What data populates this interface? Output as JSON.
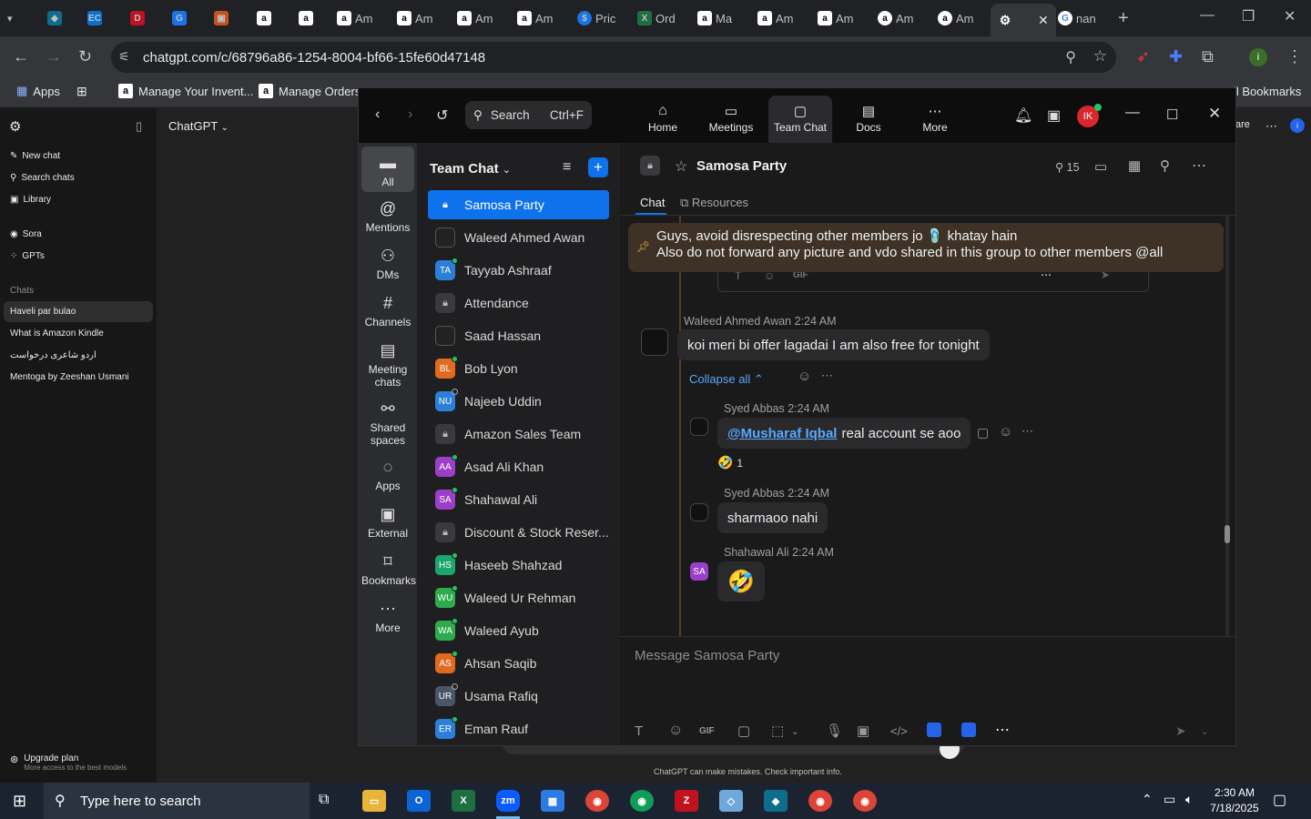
{
  "browser": {
    "tabs": [
      {
        "label": ""
      },
      {
        "label": ""
      },
      {
        "label": ""
      },
      {
        "label": ""
      },
      {
        "label": ""
      },
      {
        "label": ""
      },
      {
        "label": "Am"
      },
      {
        "label": "Am"
      },
      {
        "label": "Am"
      },
      {
        "label": "Am"
      },
      {
        "label": "Pric"
      },
      {
        "label": "Ord"
      },
      {
        "label": "Ma"
      },
      {
        "label": "Am"
      },
      {
        "label": "Am"
      },
      {
        "label": "Am"
      },
      {
        "label": "Am"
      },
      {
        "label": "nan"
      }
    ],
    "url": "chatgpt.com/c/68796a86-1254-8004-bf66-15fe60d47148",
    "bookmarks": {
      "apps": "Apps",
      "manage_inventory": "Manage Your Invent...",
      "manage_orders": "Manage Orders",
      "all_bookmarks": "All Bookmarks"
    }
  },
  "chatgpt": {
    "title": "ChatGPT",
    "new_chat": "New chat",
    "search_chats": "Search chats",
    "library": "Library",
    "sora": "Sora",
    "gpts": "GPTs",
    "chats_heading": "Chats",
    "chats": [
      "Haveli par bulao",
      "What is Amazon Kindle",
      "اردو شاعری درخواست",
      "Mentoga by Zeeshan Usmani"
    ],
    "upgrade_title": "Upgrade plan",
    "upgrade_sub": "More access to the best models",
    "disclaimer": "ChatGPT can make mistakes. Check important info.",
    "share": "are"
  },
  "zoom": {
    "search_placeholder": "Search",
    "search_shortcut": "Ctrl+F",
    "nav": [
      "Home",
      "Meetings",
      "Team Chat",
      "Docs",
      "More"
    ],
    "user_initials": "IK",
    "rail": [
      "All",
      "Mentions",
      "DMs",
      "Channels",
      "Meeting chats",
      "Shared spaces",
      "Apps",
      "External",
      "Bookmarks",
      "More"
    ],
    "list_title": "Team Chat",
    "channels": [
      {
        "name": "Samosa Party",
        "kind": "lock"
      },
      {
        "name": "Waleed Ahmed Awan",
        "kind": "photo"
      },
      {
        "name": "Tayyab Ashraaf",
        "kind": "av",
        "initials": "TA",
        "color": "#2b7fd9",
        "status": "on"
      },
      {
        "name": "Attendance",
        "kind": "lock"
      },
      {
        "name": "Saad Hassan",
        "kind": "photo"
      },
      {
        "name": "Bob Lyon",
        "kind": "av",
        "initials": "BL",
        "color": "#e06b1f",
        "status": "on"
      },
      {
        "name": "Najeeb Uddin",
        "kind": "av",
        "initials": "NU",
        "color": "#2b7fd9",
        "status": "off"
      },
      {
        "name": "Amazon Sales Team",
        "kind": "lock"
      },
      {
        "name": "Asad Ali Khan",
        "kind": "av",
        "initials": "AA",
        "color": "#9b3fc9",
        "status": "on"
      },
      {
        "name": "Shahawal Ali",
        "kind": "av",
        "initials": "SA",
        "color": "#9b3fc9",
        "status": "on"
      },
      {
        "name": "Discount & Stock Reser...",
        "kind": "lock"
      },
      {
        "name": "Haseeb Shahzad",
        "kind": "av",
        "initials": "HS",
        "color": "#1ea56b",
        "status": "on"
      },
      {
        "name": "Waleed Ur Rehman",
        "kind": "av",
        "initials": "WU",
        "color": "#2eab4c",
        "status": "on"
      },
      {
        "name": "Waleed Ayub",
        "kind": "av",
        "initials": "WA",
        "color": "#2eab4c",
        "status": "on"
      },
      {
        "name": "Ahsan Saqib",
        "kind": "av",
        "initials": "AS",
        "color": "#e06b1f",
        "status": "on"
      },
      {
        "name": "Usama Rafiq",
        "kind": "av",
        "initials": "UR",
        "color": "#4a5568",
        "status": "off"
      },
      {
        "name": "Eman Rauf",
        "kind": "av",
        "initials": "ER",
        "color": "#2b7fd9",
        "status": "on"
      }
    ],
    "chat": {
      "title": "Samosa Party",
      "member_count": "15",
      "tab_chat": "Chat",
      "tab_resources": "Resources",
      "pinned_line1": "Guys, avoid disrespecting other members jo 🩴 khatay hain",
      "pinned_line2": "Also do not forward any picture and vdo shared in this group to other members @all",
      "messages": [
        {
          "sender": "Waleed Ahmed Awan",
          "time": "2:24 AM",
          "text": "koi meri bi offer lagadai I am also free for tonight"
        },
        {
          "sender": "Syed Abbas",
          "time": "2:24 AM",
          "mention": "@Musharaf Iqbal",
          "text": "real account se aoo",
          "reaction": "🤣",
          "reaction_count": "1"
        },
        {
          "sender": "Syed Abbas",
          "time": "2:24 AM",
          "text": "sharmaoo nahi"
        },
        {
          "sender": "Shahawal Ali",
          "time": "2:24 AM",
          "initials": "SA",
          "text": "🤣"
        }
      ],
      "collapse_all": "Collapse all",
      "composer_placeholder": "Message Samosa Party",
      "gif": "GIF"
    }
  },
  "taskbar": {
    "search_placeholder": "Type here to search",
    "time": "2:30 AM",
    "date": "7/18/2025"
  }
}
